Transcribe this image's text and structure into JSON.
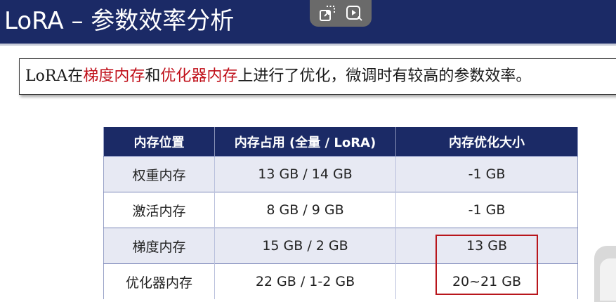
{
  "slide": {
    "title": "LoRA – 参数效率分析",
    "callout": {
      "parts": [
        "LoRA在",
        "梯度内存",
        "和",
        "优化器内存",
        "上进行了优化，微调时有较高的参数效率。"
      ]
    }
  },
  "overlay": {
    "icons": [
      "exit-fullscreen-icon",
      "play-video-icon"
    ]
  },
  "table": {
    "headers": [
      "内存位置",
      "内存占用 (全量 / LoRA)",
      "内存优化大小"
    ],
    "rows": [
      [
        "权重内存",
        "13 GB / 14 GB",
        "-1 GB"
      ],
      [
        "激活内存",
        "8 GB / 9 GB",
        "-1 GB"
      ],
      [
        "梯度内存",
        "15 GB / 2 GB",
        "13 GB"
      ],
      [
        "优化器内存",
        "22 GB / 1-2 GB",
        "20~21 GB"
      ]
    ]
  },
  "colors": {
    "title_bar": "#1b2a66",
    "highlight": "#c0101a",
    "row_alt": "#e7e9f3",
    "box_outline": "#b8161c"
  }
}
